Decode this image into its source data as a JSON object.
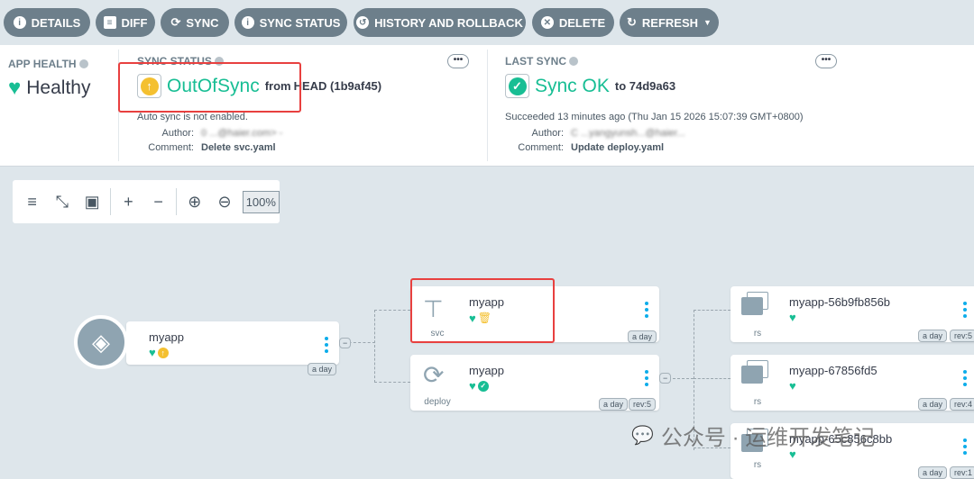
{
  "toolbar": {
    "buttons": [
      {
        "label": "DETAILS",
        "icon": "info-icon"
      },
      {
        "label": "DIFF",
        "icon": "file-icon"
      },
      {
        "label": "SYNC",
        "icon": "sync-icon"
      },
      {
        "label": "SYNC STATUS",
        "icon": "info-icon"
      },
      {
        "label": "HISTORY AND ROLLBACK",
        "icon": "history-icon"
      },
      {
        "label": "DELETE",
        "icon": "times-circle-icon"
      },
      {
        "label": "REFRESH",
        "icon": "redo-icon"
      }
    ]
  },
  "app_health": {
    "title": "APP HEALTH",
    "status": "Healthy"
  },
  "sync_status": {
    "title": "SYNC STATUS",
    "status": "OutOfSync",
    "from": "from",
    "revision": "HEAD (1b9af45)",
    "auto_sync": "Auto sync is not enabled.",
    "author_label": "Author:",
    "author": "0 ...@haier.com> -",
    "comment_label": "Comment:",
    "comment": "Delete svc.yaml"
  },
  "last_sync": {
    "title": "LAST SYNC",
    "status": "Sync OK",
    "to": "to 74d9a63",
    "succeeded": "Succeeded 13 minutes ago (Thu Jan 15 2026 15:07:39 GMT+0800)",
    "author_label": "Author:",
    "author": "C ...yangyunsh...@haier...",
    "comment_label": "Comment:",
    "comment": "Update deploy.yaml"
  },
  "more": "•••",
  "zoom": {
    "level": "100%"
  },
  "nodes": {
    "app": {
      "name": "myapp",
      "age": "a day"
    },
    "svc": {
      "name": "myapp",
      "kind": "svc",
      "age": "a day"
    },
    "deploy": {
      "name": "myapp",
      "kind": "deploy",
      "age": "a day",
      "rev": "rev:5"
    },
    "rs": [
      {
        "name": "myapp-56b9fb856b",
        "kind": "rs",
        "age": "a day",
        "rev": "rev:5"
      },
      {
        "name": "myapp-67856fd5",
        "kind": "rs",
        "age": "a day",
        "rev": "rev:4"
      },
      {
        "name": "myapp-65c856c8bb",
        "kind": "rs",
        "age": "a day",
        "rev": "rev:1"
      }
    ]
  },
  "watermark": "公众号 · 运维开发笔记",
  "colors": {
    "healthy": "#18be94",
    "outofsync": "#f4c030",
    "button": "#6d7f8b",
    "highlight": "#e8403f",
    "link": "#0dadea"
  }
}
